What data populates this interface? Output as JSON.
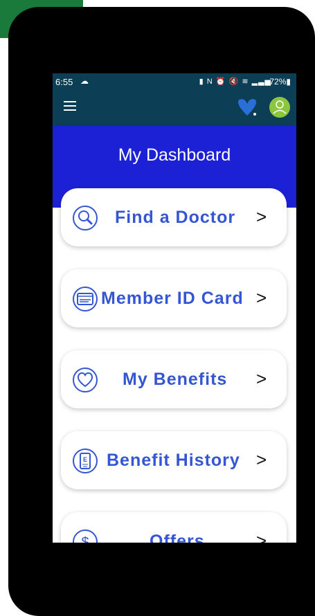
{
  "status": {
    "time": "6:55",
    "battery": "72%"
  },
  "dashboard": {
    "title": "My Dashboard"
  },
  "cards": [
    {
      "label": "Find a Doctor",
      "icon": "search-icon"
    },
    {
      "label": "Member ID Card",
      "icon": "id-card-icon"
    },
    {
      "label": "My Benefits",
      "icon": "heart-icon"
    },
    {
      "label": "Benefit History",
      "icon": "eye-chart-icon"
    },
    {
      "label": "Offers",
      "icon": "dollar-icon"
    }
  ],
  "colors": {
    "appbar": "#0c3e55",
    "hero": "#1d21d6",
    "accent": "#3556d4",
    "avatar": "#8cc63f"
  }
}
